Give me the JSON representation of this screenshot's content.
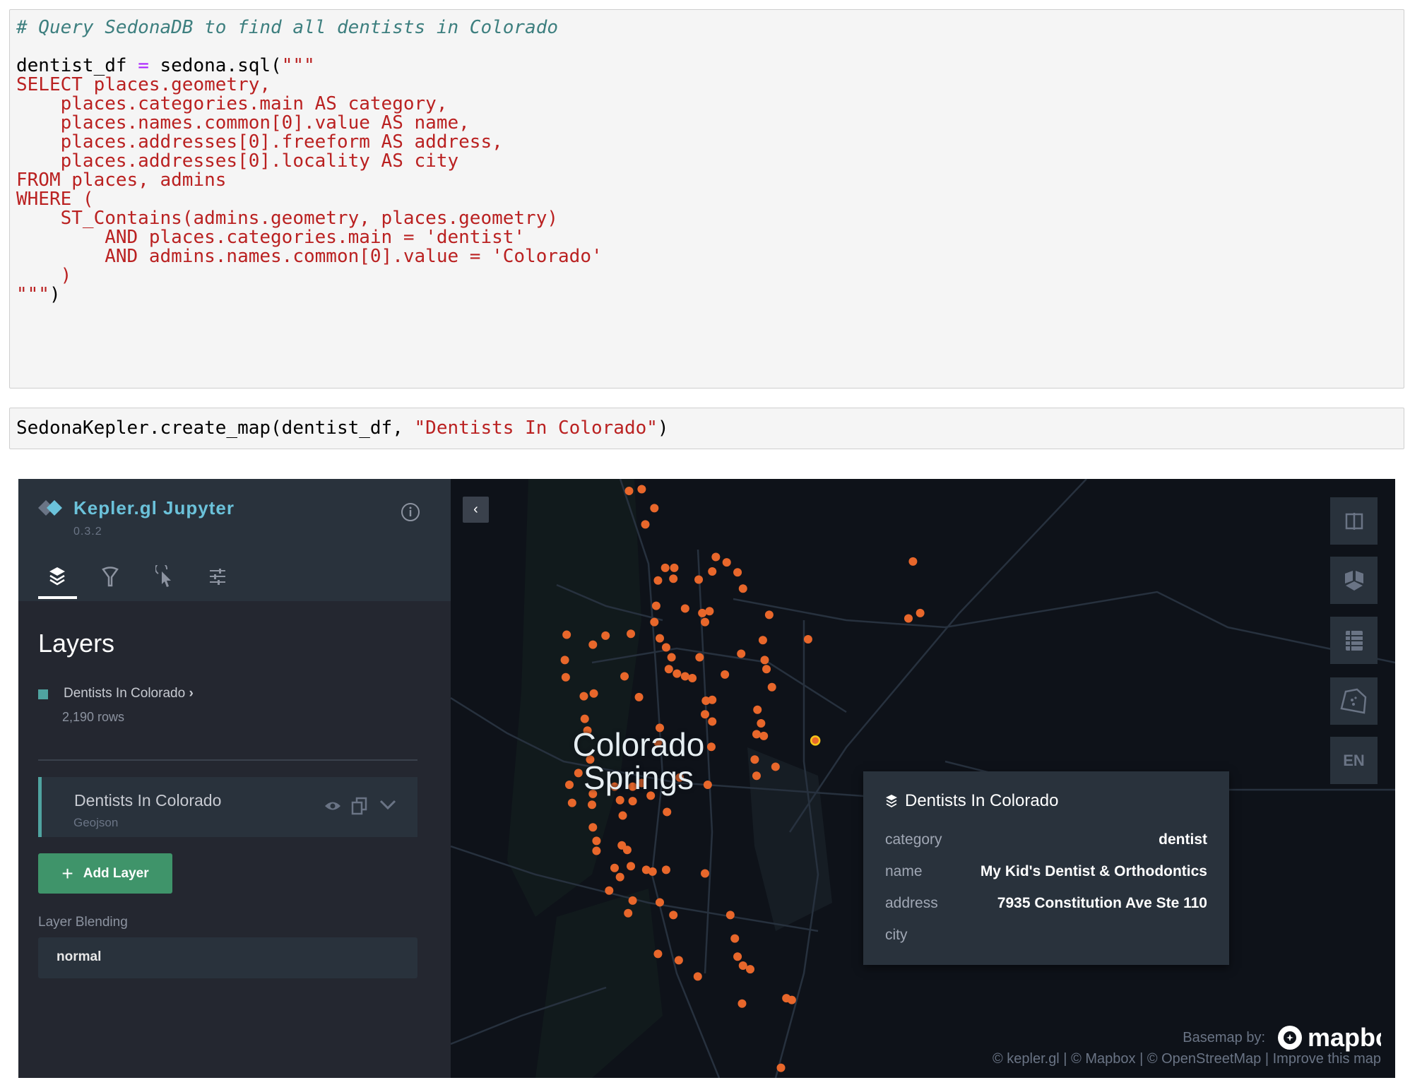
{
  "cell1": {
    "lines": [
      [
        {
          "t": "# Query SedonaDB to find all dentists in Colorado",
          "c": "com"
        }
      ],
      [
        {
          "t": "",
          "c": "pl"
        }
      ],
      [
        {
          "t": "dentist_df ",
          "c": "pl"
        },
        {
          "t": "=",
          "c": "op"
        },
        {
          "t": " sedona.sql(",
          "c": "pl"
        },
        {
          "t": "\"\"\"",
          "c": "str"
        }
      ],
      [
        {
          "t": "SELECT places.geometry,",
          "c": "str"
        }
      ],
      [
        {
          "t": "    places.categories.main AS category,",
          "c": "str"
        }
      ],
      [
        {
          "t": "    places.names.common[0].value AS name,",
          "c": "str"
        }
      ],
      [
        {
          "t": "    places.addresses[0].freeform AS address,",
          "c": "str"
        }
      ],
      [
        {
          "t": "    places.addresses[0].locality AS city",
          "c": "str"
        }
      ],
      [
        {
          "t": "FROM places, admins",
          "c": "str"
        }
      ],
      [
        {
          "t": "WHERE (",
          "c": "str"
        }
      ],
      [
        {
          "t": "    ST_Contains(admins.geometry, places.geometry)",
          "c": "str"
        }
      ],
      [
        {
          "t": "        AND places.categories.main = 'dentist'",
          "c": "str"
        }
      ],
      [
        {
          "t": "        AND admins.names.common[0].value = 'Colorado'",
          "c": "str"
        }
      ],
      [
        {
          "t": "    )",
          "c": "str"
        }
      ],
      [
        {
          "t": "\"\"\"",
          "c": "str"
        },
        {
          "t": ")",
          "c": "pl"
        }
      ]
    ]
  },
  "cell2": {
    "lines": [
      [
        {
          "t": "SedonaKepler.create_map(dentist_df, ",
          "c": "pl"
        },
        {
          "t": "\"Dentists In Colorado\"",
          "c": "str"
        },
        {
          "t": ")",
          "c": "pl"
        }
      ]
    ]
  },
  "kepler": {
    "app_title": "Kepler.gl Jupyter",
    "version": "0.3.2",
    "tabs": [
      {
        "icon": "layers-icon"
      },
      {
        "icon": "filter-icon"
      },
      {
        "icon": "interaction-icon"
      },
      {
        "icon": "map-settings-icon"
      }
    ],
    "active_tab": "layers",
    "section_title": "Layers",
    "dataset": {
      "name": "Dentists In Colorado",
      "rows": "2,190 rows",
      "color": "#4fa3a0"
    },
    "layer": {
      "title": "Dentists In Colorado",
      "type": "Geojson"
    },
    "add_layer_label": "Add Layer",
    "blending_label": "Layer Blending",
    "blending_value": "normal",
    "map": {
      "city_label_1": "Colorado",
      "city_label_2": "Springs",
      "point_color": "#e8672b",
      "highlight_color": "#f5c518",
      "controls": [
        {
          "icon": "split-map-icon"
        },
        {
          "icon": "3d-view-icon"
        },
        {
          "icon": "legend-icon"
        },
        {
          "icon": "draw-polygon-icon"
        },
        {
          "label": "EN"
        }
      ],
      "tooltip": {
        "title": "Dentists In Colorado",
        "rows": [
          {
            "key": "category",
            "value": "dentist"
          },
          {
            "key": "name",
            "value": "My Kid's Dentist & Orthodontics"
          },
          {
            "key": "address",
            "value": "7935 Constitution Ave Ste 110"
          },
          {
            "key": "city",
            "value": ""
          }
        ]
      },
      "basemap_label": "Basemap by:",
      "mapbox_text": "mapbox",
      "attribution": "© kepler.gl | © Mapbox | © OpenStreetMap | Improve this map"
    }
  }
}
